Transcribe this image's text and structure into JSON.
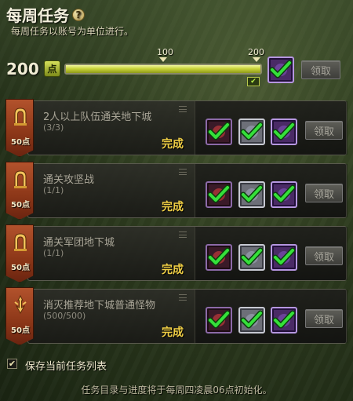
{
  "header": {
    "title": "每周任务",
    "help_icon": "?",
    "subtitle": "每周任务以账号为单位进行。"
  },
  "progress": {
    "points": "200",
    "points_badge": "点",
    "fill_fraction": 1.0,
    "milestones": [
      "100",
      "200"
    ],
    "claim_label": "领取"
  },
  "quests": [
    {
      "name": "2人以上队伍通关地下城",
      "progress": "(3/3)",
      "status": "完成",
      "points": "50点",
      "banner_icon": "gate-icon",
      "claim_label": "领取"
    },
    {
      "name": "通关攻坚战",
      "progress": "(1/1)",
      "status": "完成",
      "points": "50点",
      "banner_icon": "gate-icon",
      "claim_label": "领取"
    },
    {
      "name": "通关军团地下城",
      "progress": "(1/1)",
      "status": "完成",
      "points": "50点",
      "banner_icon": "gate-icon",
      "claim_label": "领取"
    },
    {
      "name": "消灭推荐地下城普通怪物",
      "progress": "(500/500)",
      "status": "完成",
      "points": "50点",
      "banner_icon": "sword-icon",
      "claim_label": "领取"
    }
  ],
  "footer": {
    "checkbox_label": "保存当前任务列表",
    "checkbox_checked": true,
    "note": "任务目录与进度将于每周四凌晨06点初始化。"
  },
  "colors": {
    "checkmark": "#35e03a",
    "banner": "#a44726",
    "done_text": "#f0cf45",
    "bar_fill": "#c9d43a"
  }
}
